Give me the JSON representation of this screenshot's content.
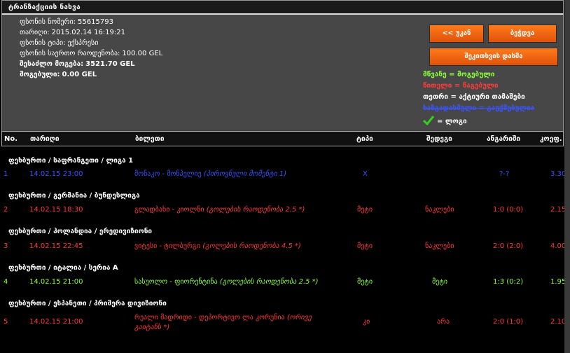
{
  "title": "ტრანზაქციის ნახვა",
  "info": {
    "phone_number": {
      "label": "ფსონის ნომერი:",
      "value": "55615793"
    },
    "date": {
      "label": "თარიღი:",
      "value": "2015.02.14 16:19:21"
    },
    "bet_type": {
      "label": "ფსონის ტიპი:",
      "value": "ექსპრესი"
    },
    "total_odds": {
      "label": "ფსონის საერთო რაოდენობა:",
      "value": "100.00 GEL"
    },
    "possible_win": {
      "label": "შესაძლო მოგება:",
      "value": "3521.70 GEL"
    },
    "winnings": {
      "label": "მოგებული:",
      "value": "0.00 GEL"
    }
  },
  "buttons": {
    "back": "<< უკან",
    "print": "ბეჭდვა",
    "close_receipt": "შეკითხვის დასმა"
  },
  "legend": {
    "green": "მწვანე = მოგებული",
    "red": "წითელი = წაგებული",
    "white": "თეთრი = აქტიური თამაშები",
    "blue": "ხაზგადასმული = გაუქმებულია",
    "check": "= ლოგი"
  },
  "colors": {
    "accent": "#f26b12",
    "green": "#8cff3a",
    "red": "#ff3a3a",
    "blue": "#3a54ff",
    "panel": "#474747"
  },
  "columns": [
    "No.",
    "თარიღი",
    "ბილეთი",
    "ტიპი",
    "შედეგი",
    "ანგარიში",
    "კოეფ."
  ],
  "groups": [
    {
      "league": "ფეხბურთი / საფრანგეთი / ლიგა 1",
      "no": "1",
      "date": "14.02.15 23:00",
      "ticket": "მონაკო - მონპელიე",
      "ticket_note": "(პიროვნული მომენტი 1)",
      "type": "X",
      "result": "",
      "score": "?-?",
      "odds": "3.30",
      "status": "cancelled"
    },
    {
      "league": "ფეხბურთი / გერმანია / ბუნდესლიგა",
      "no": "2",
      "date": "14.02.15 18:30",
      "ticket": "გლადბახი - კიოლნი",
      "ticket_note": "(გოლების რაოდენობა 2.5 *)",
      "type": "მეტი",
      "result": "ნაკლები",
      "score": "1:0 (0:0)",
      "odds": "2.15",
      "status": "lost"
    },
    {
      "league": "ფეხბურთი / ჰოლანდია / ერედივიზიონი",
      "no": "3",
      "date": "14.02.15 22:45",
      "ticket": "ვიტესი - ტილბურგი",
      "ticket_note": "(გოლების რაოდენობა 4.5 *)",
      "type": "მეტი",
      "result": "ნაკლები",
      "score": "2:0 (2:0)",
      "odds": "4.00",
      "status": "lost"
    },
    {
      "league": "ფეხბურთი / იტალია / სერია A",
      "no": "4",
      "date": "14.02.15 21:00",
      "ticket": "სასუოლო - ფიორენტინა",
      "ticket_note": "(გოლების რაოდენობა 2.5 *)",
      "type": "მეტი",
      "result": "მეტი",
      "score": "1:3 (0:2)",
      "odds": "1.95",
      "status": "won"
    },
    {
      "league": "ფეხბურთი / ესპანეთი / პრიმერა დივიზიონი",
      "no": "5",
      "date": "14.02.15 21:00",
      "ticket": "რეალი მადრიდი - დეპორტივო ლა კორუნია",
      "ticket_note": "(ორივე გაიტანს *)",
      "type": "კი",
      "result": "არა",
      "score": "2:0 (1:0)",
      "odds": "2.10",
      "status": "lost"
    }
  ]
}
